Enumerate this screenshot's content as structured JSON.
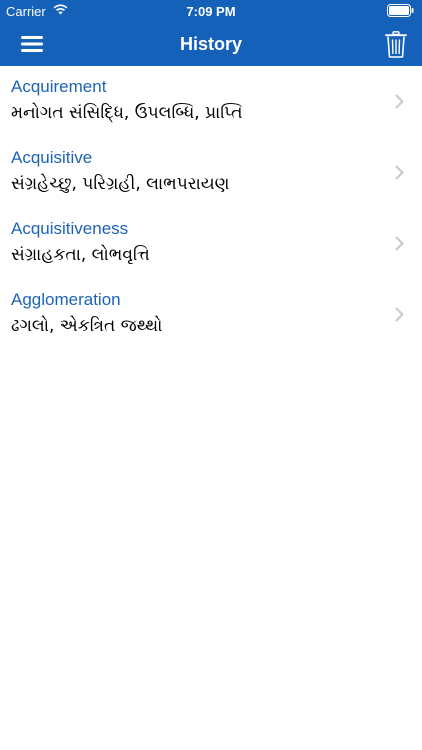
{
  "status_bar": {
    "carrier": "Carrier",
    "time": "7:09 PM",
    "wifi_icon": "wifi-icon",
    "battery_icon": "battery-icon"
  },
  "nav": {
    "title": "History",
    "menu_icon": "hamburger-menu-icon",
    "delete_icon": "trash-icon"
  },
  "colors": {
    "header_bg": "#1561ba",
    "word_text": "#1d63b8",
    "meaning_text": "#000000",
    "chevron": "#c7c7cc"
  },
  "history": {
    "items": [
      {
        "word": "Acquirement",
        "meaning": "મનોગત સંસિદ્ધિ, ઉપલબ્ધિ, પ્રાપ્તિ"
      },
      {
        "word": "Acquisitive",
        "meaning": "સંગ્રહેચ્છુ, પરિગ્રહી, લાભપરાયણ"
      },
      {
        "word": "Acquisitiveness",
        "meaning": "સંગ્રાહકતા, લોભવૃત્તિ"
      },
      {
        "word": "Agglomeration",
        "meaning": "ઢગલો, એકત્રિત જથ્થો"
      }
    ]
  }
}
